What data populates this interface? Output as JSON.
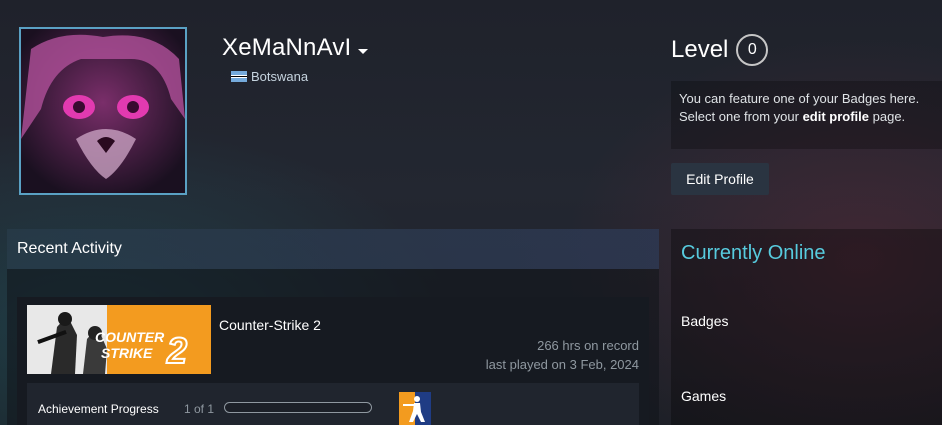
{
  "profile": {
    "persona_name": "XeMaNnAvI",
    "country": "Botswana",
    "avatar": "anime-girl-heart-hands-avatar"
  },
  "level": {
    "label": "Level",
    "value": "0"
  },
  "badge_box": {
    "text_1": "You can feature one of your Badges here. Select one from your ",
    "link": "edit profile",
    "text_2": " page."
  },
  "edit_profile_label": "Edit Profile",
  "recent_activity": {
    "title": "Recent Activity",
    "games": [
      {
        "name": "Counter-Strike 2",
        "hours": "266 hrs on record",
        "last_played": "last played on 3 Feb, 2024",
        "capsule_text_1": "COUNTER",
        "capsule_text_2": "STRIKE",
        "capsule_num": "2",
        "achievement_label": "Achievement Progress",
        "achievement_count": "1 of 1",
        "achievement_fraction": 0
      }
    ]
  },
  "sidebar": {
    "status": "Currently Online",
    "items": [
      {
        "label": "Badges"
      },
      {
        "label": "Games"
      }
    ]
  },
  "colors": {
    "accent_online": "#57cbde",
    "capsule_orange": "#f39b1f",
    "avatar_border": "#5aa1c4"
  }
}
